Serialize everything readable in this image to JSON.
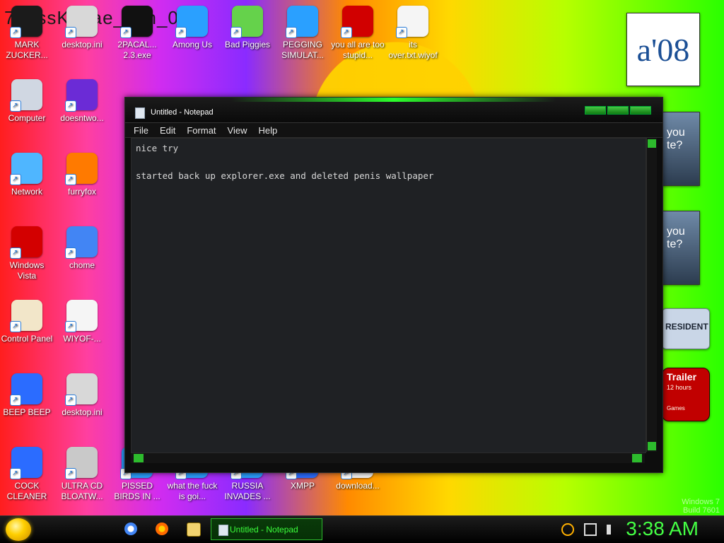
{
  "background": {
    "title_text": "7_ossKanae_tion_012"
  },
  "desktop": {
    "icons": [
      {
        "label": "MARK ZUCKER...",
        "icon": "photo-icon"
      },
      {
        "label": "desktop.ini",
        "icon": "gear-file-icon"
      },
      {
        "label": "2PACAL... 2.3.exe",
        "icon": "console-icon"
      },
      {
        "label": "Among Us",
        "icon": "game-icon"
      },
      {
        "label": "Bad Piggies",
        "icon": "pig-icon"
      },
      {
        "label": "PEGGING SIMULAT...",
        "icon": "game-icon"
      },
      {
        "label": "you all are too stupid...",
        "icon": "devcpp-icon"
      },
      {
        "label": "its over.txt.wiyof",
        "icon": "document-icon"
      },
      {
        "label": "Computer",
        "icon": "computer-icon"
      },
      {
        "label": "doesntwo...",
        "icon": "yahoo-icon"
      },
      {
        "label": "Network",
        "icon": "network-icon"
      },
      {
        "label": "furryfox",
        "icon": "firefox-icon"
      },
      {
        "label": "Windows Vista",
        "icon": "recycle-bin-icon"
      },
      {
        "label": "chome",
        "icon": "chrome-icon"
      },
      {
        "label": "Control Panel",
        "icon": "control-panel-icon"
      },
      {
        "label": "WIYOF-...",
        "icon": "document-icon"
      },
      {
        "label": "BEEP BEEP",
        "icon": "app-icon"
      },
      {
        "label": "desktop.ini",
        "icon": "gear-file-icon"
      },
      {
        "label": "COCK CLEANER",
        "icon": "app-icon"
      },
      {
        "label": "ULTRA CD BLOATW...",
        "icon": "cd-icon"
      },
      {
        "label": "PISSED BIRDS IN ...",
        "icon": "game-icon"
      },
      {
        "label": "what the fuck is goi...",
        "icon": "game-icon"
      },
      {
        "label": "RUSSIA INVADES ...",
        "icon": "game-icon"
      },
      {
        "label": "XMPP",
        "icon": "app-icon"
      },
      {
        "label": "download...",
        "icon": "document-icon"
      }
    ]
  },
  "notepad": {
    "title": "Untitled - Notepad",
    "menu": [
      "File",
      "Edit",
      "Format",
      "View",
      "Help"
    ],
    "content": "nice try\n\nstarted back up explorer.exe and deleted penis wallpaper"
  },
  "right_panel": {
    "card1_text": "a'08",
    "card2_text": "you te?",
    "card3_text": "you te?",
    "card4_text": "RESIDENT",
    "card5_title": "Trailer",
    "card5_sub": "12 hours",
    "card5_foot": "Games"
  },
  "watermark": {
    "line1": "Windows 7",
    "line2": "Build 7601"
  },
  "taskbar": {
    "task_label": "Untitled - Notepad",
    "clock": "3:38 AM"
  },
  "colors": {
    "accent_green": "#44ff44"
  }
}
